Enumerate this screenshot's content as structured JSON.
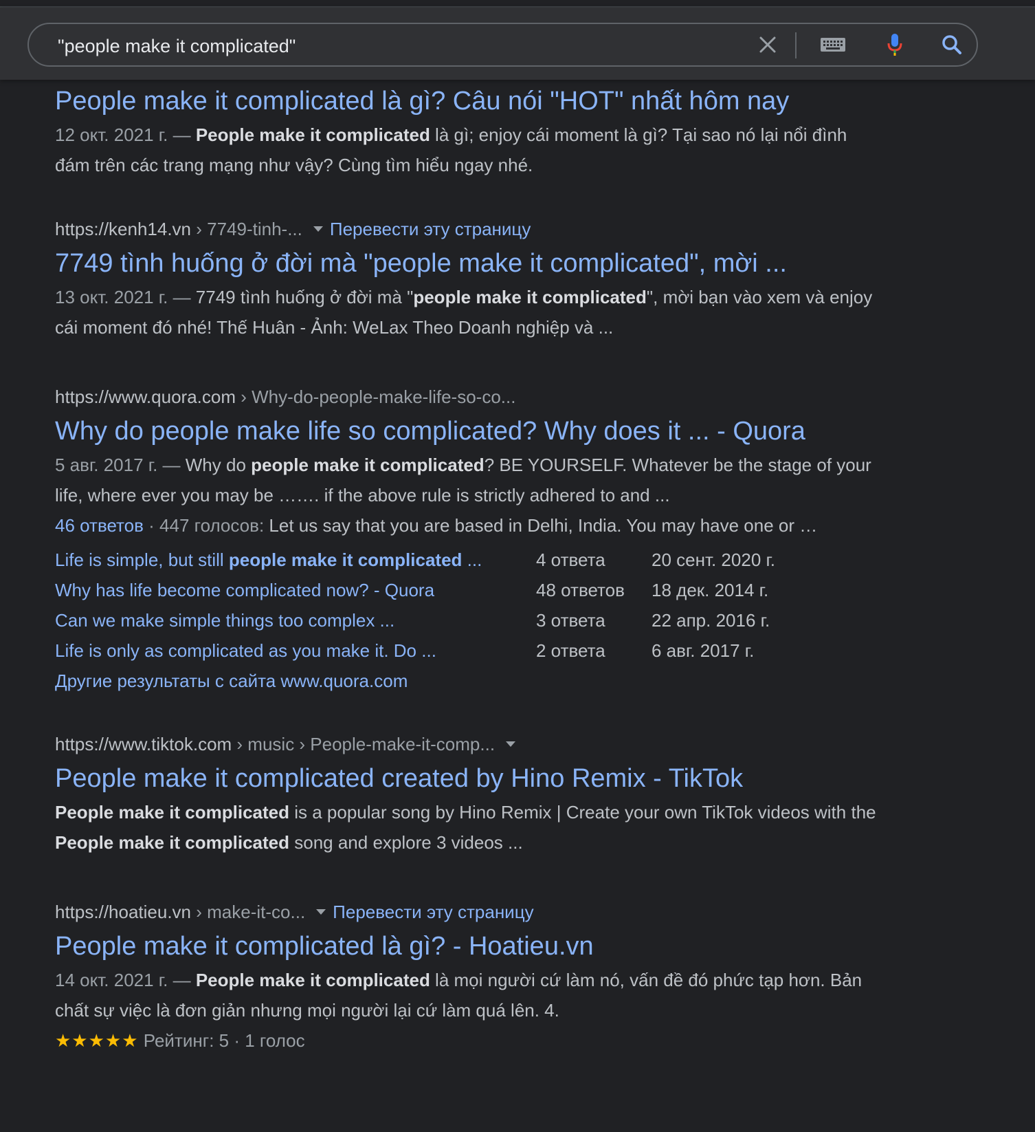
{
  "search": {
    "query": "\"people make it complicated\""
  },
  "icons": {
    "clear": "close-icon",
    "keyboard": "keyboard-icon",
    "mic": "microphone-icon",
    "search": "search-icon"
  },
  "colors": {
    "background": "#202124",
    "header": "#303134",
    "link": "#8ab4f8",
    "text": "#bdc1c6",
    "star": "#fbbc04"
  },
  "results": [
    {
      "title": "People make it complicated là gì? Câu nói \"HOT\" nhất hôm nay",
      "date": "12 окт. 2021 г. —",
      "snippet_bold": "People make it complicated",
      "snippet_rest": " là gì; enjoy cái moment là gì? Tại sao nó lại nổi đình đám trên các trang mạng như vậy? Cùng tìm hiểu ngay nhé."
    },
    {
      "cite_domain": "https://kenh14.vn",
      "cite_path": " › 7749-tinh-...",
      "translate": "Перевести эту страницу",
      "title": "7749 tình huống ở đời mà \"people make it complicated\", mời ...",
      "date": "13 окт. 2021 г. —",
      "snippet_pre": " 7749 tình huống ở đời mà \"",
      "snippet_bold": "people make it complicated",
      "snippet_rest": "\", mời bạn vào xem và enjoy cái moment đó nhé! Thế Huân - Ảnh: WeLax Theo Doanh nghiệp và ..."
    },
    {
      "cite_domain": "https://www.quora.com",
      "cite_path": " › Why-do-people-make-life-so-co...",
      "title": "Why do people make life so complicated? Why does it ... - Quora",
      "date": "5 авг. 2017 г. —",
      "snippet_pre": " Why do ",
      "snippet_bold": "people make it complicated",
      "snippet_rest": "? BE YOURSELF. Whatever be the stage of your life, where ever you may be ……. if the above rule is strictly adhered to and ...",
      "answers_link": "46 ответов",
      "votes": " · 447 голосов: ",
      "answers_text": "Let us say that you are based in Delhi, India. You may have one or …",
      "sitelinks": [
        {
          "pre": "Life is simple, but still ",
          "bold": "people make it complicated",
          "post": " ...",
          "count": "4 ответа",
          "date": "20 сент. 2020 г."
        },
        {
          "pre": "Why has life become complicated now? - Quora",
          "bold": "",
          "post": "",
          "count": "48 ответов",
          "date": "18 дек. 2014 г."
        },
        {
          "pre": "Can we make simple things too complex ...",
          "bold": "",
          "post": "",
          "count": "3 ответа",
          "date": "22 апр. 2016 г."
        },
        {
          "pre": "Life is only as complicated as you make it. Do ...",
          "bold": "",
          "post": "",
          "count": "2 ответа",
          "date": "6 авг. 2017 г."
        }
      ],
      "more": "Другие результаты с сайта www.quora.com"
    },
    {
      "cite_domain": "https://www.tiktok.com",
      "cite_path": " › music › People-make-it-comp...",
      "title": "People make it complicated created by Hino Remix - TikTok",
      "snippet_bold": "People make it complicated",
      "snippet_mid": " is a popular song by Hino Remix | Create your own TikTok videos with the ",
      "snippet_bold2": "People make it complicated",
      "snippet_rest": " song and explore 3 videos ..."
    },
    {
      "cite_domain": "https://hoatieu.vn",
      "cite_path": " › make-it-co...",
      "translate": "Перевести эту страницу",
      "title": "People make it complicated là gì? - Hoatieu.vn",
      "date": "14 окт. 2021 г. —",
      "snippet_bold": "People make it complicated",
      "snippet_rest": " là mọi người cứ làm nó, vấn đề đó phức tạp hơn. Bản chất sự việc là đơn giản nhưng mọi người lại cứ làm quá lên. 4.",
      "stars": "★★★★★",
      "rating": 5,
      "rating_text": " Рейтинг: 5 · 1 голос"
    }
  ]
}
